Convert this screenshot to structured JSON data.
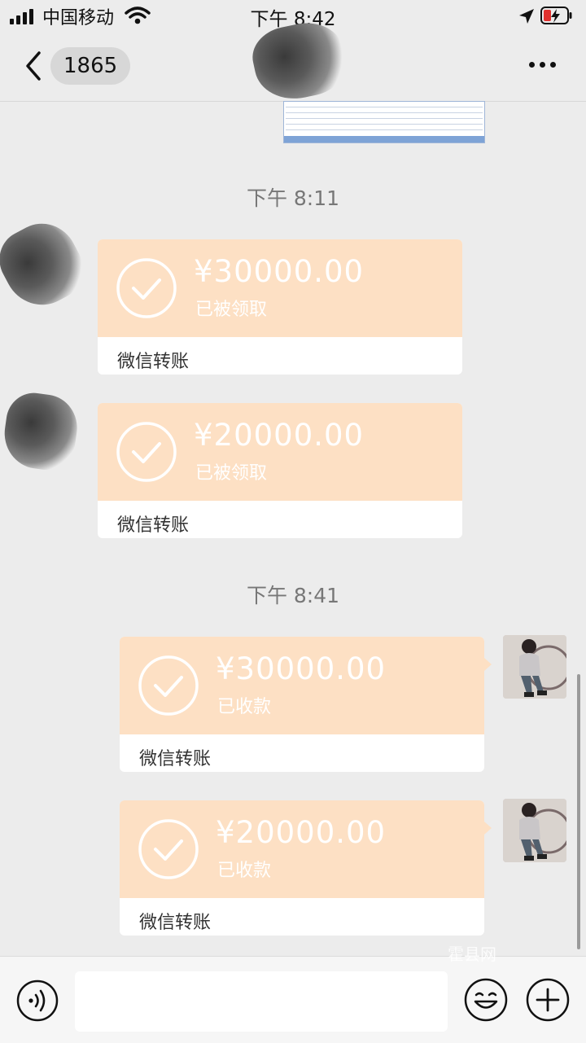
{
  "status_bar": {
    "carrier": "中国移动",
    "time": "下午 8:42"
  },
  "nav": {
    "unread_count": "1865"
  },
  "timestamps": [
    "下午 8:11",
    "下午 8:41"
  ],
  "messages": [
    {
      "sender": "them",
      "amount": "¥30000.00",
      "status": "已被领取",
      "type_label": "微信转账"
    },
    {
      "sender": "them",
      "amount": "¥20000.00",
      "status": "已被领取",
      "type_label": "微信转账"
    },
    {
      "sender": "me",
      "amount": "¥30000.00",
      "status": "已收款",
      "type_label": "微信转账"
    },
    {
      "sender": "me",
      "amount": "¥20000.00",
      "status": "已收款",
      "type_label": "微信转账"
    }
  ],
  "watermark": "霍县网",
  "colors": {
    "transfer_card": "#fde0c4",
    "page_background": "#ececec"
  },
  "icons": [
    "signal-icon",
    "wifi-icon",
    "location-arrow-icon",
    "battery-charging-icon",
    "back-chevron-icon",
    "more-icon",
    "check-circle-icon",
    "voice-icon",
    "emoji-icon",
    "plus-icon"
  ]
}
